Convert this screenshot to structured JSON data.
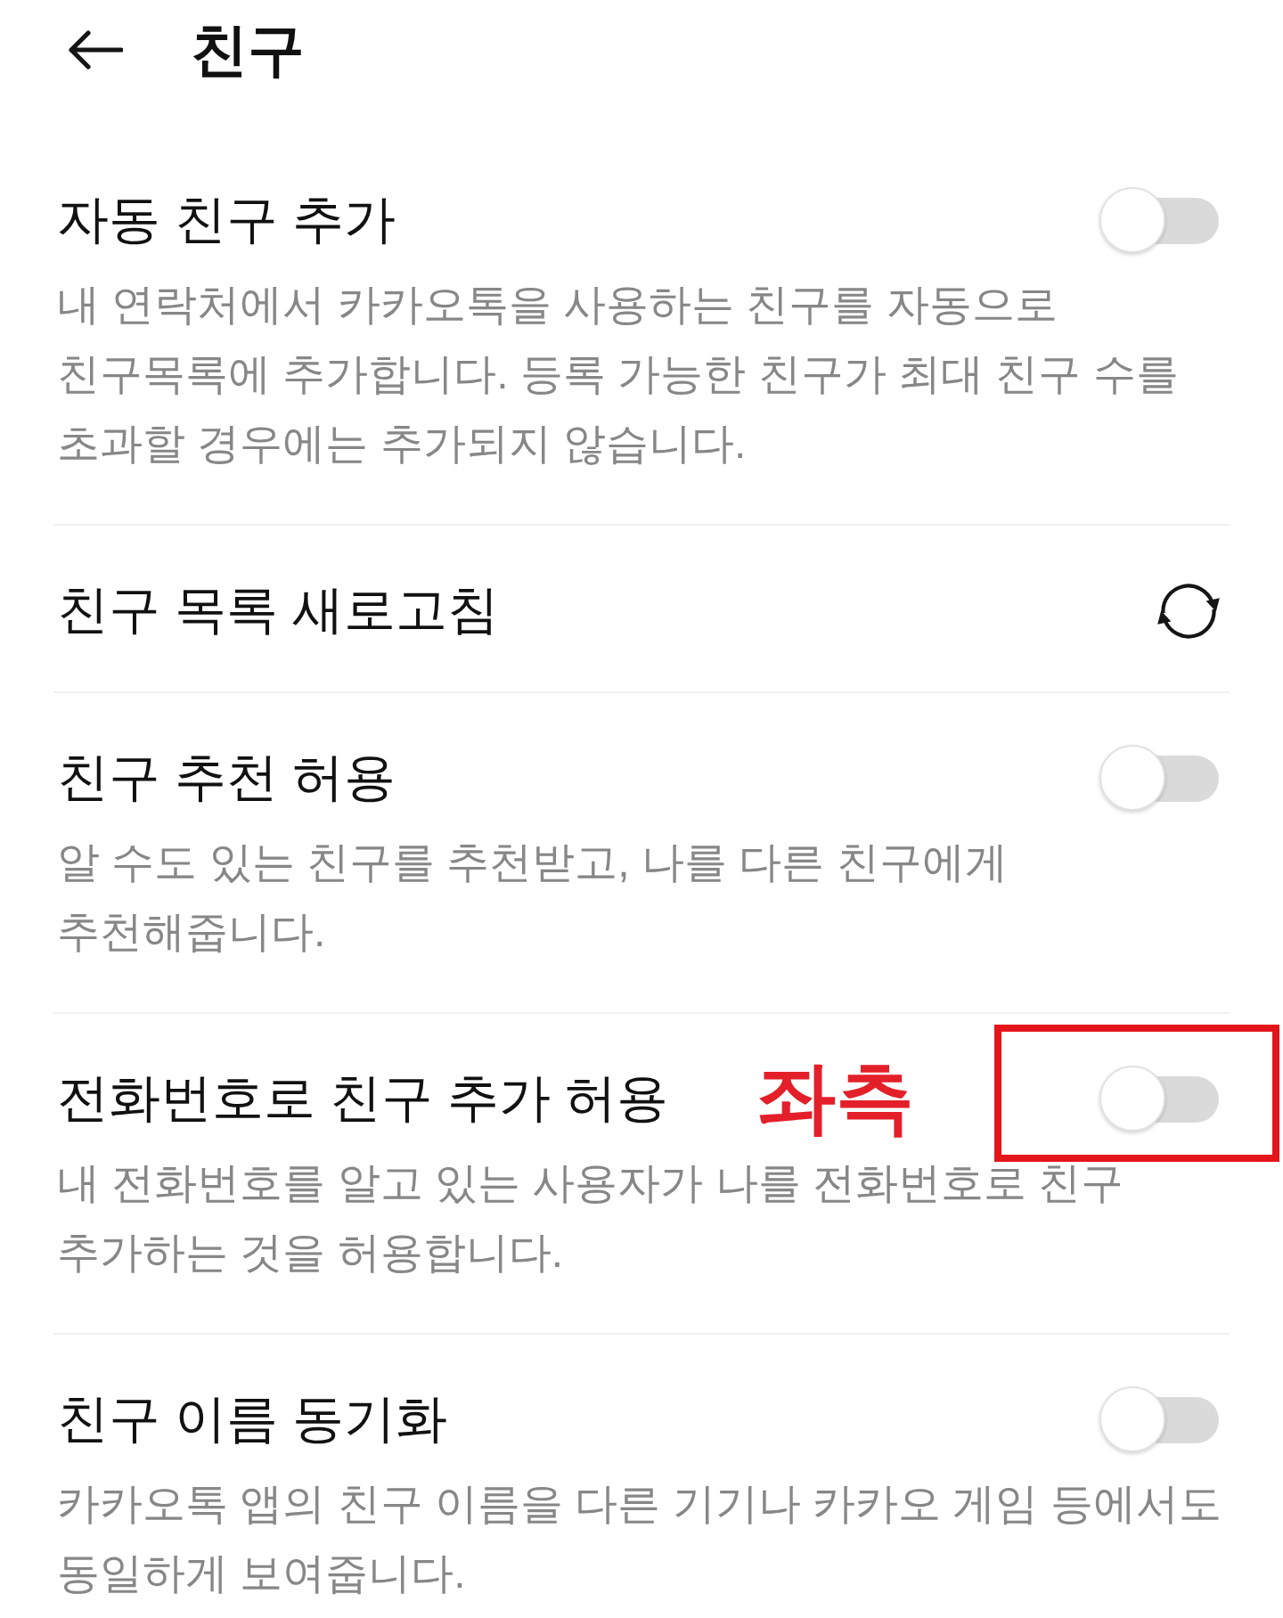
{
  "header": {
    "title": "친구"
  },
  "settings": [
    {
      "kind": "toggle",
      "title": "자동 친구 추가",
      "description": "내 연락처에서 카카오톡을 사용하는 친구를 자동으로\n친구목록에 추가합니다. 등록 가능한 친구가 최대 친구 수를\n초과할 경우에는 추가되지 않습니다.",
      "on": false,
      "highlighted": false
    },
    {
      "kind": "action",
      "title": "친구 목록 새로고침",
      "highlighted": false
    },
    {
      "kind": "toggle",
      "title": "친구 추천 허용",
      "description": "알 수도 있는 친구를 추천받고, 나를 다른 친구에게\n추천해줍니다.",
      "on": false,
      "highlighted": false
    },
    {
      "kind": "toggle",
      "title": "전화번호로 친구 추가 허용",
      "annotation": "좌측",
      "description": "내 전화번호를 알고 있는 사용자가 나를 전화번호로 친구\n추가하는 것을 허용합니다.",
      "on": false,
      "highlighted": true
    },
    {
      "kind": "toggle",
      "title": "친구 이름 동기화",
      "description": "카카오톡 앱의 친구 이름을 다른 기기나 카카오 게임 등에서도\n동일하게 보여줍니다.",
      "on": false,
      "highlighted": false
    }
  ]
}
